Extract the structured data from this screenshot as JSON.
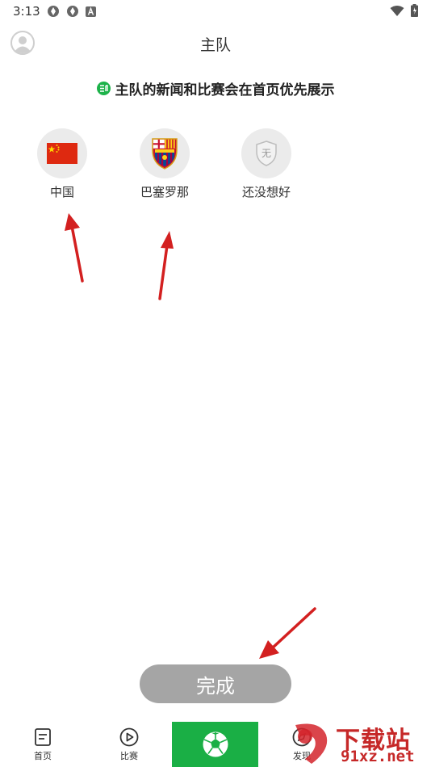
{
  "status_bar": {
    "time": "3:13"
  },
  "header": {
    "title": "主队"
  },
  "notice": {
    "text": "主队的新闻和比赛会在首页优先展示"
  },
  "teams": [
    {
      "name": "中国"
    },
    {
      "name": "巴塞罗那"
    },
    {
      "name": "还没想好",
      "badge_text": "无"
    }
  ],
  "done_button": {
    "label": "完成"
  },
  "bottom_nav": {
    "items": [
      {
        "label": "首页"
      },
      {
        "label": "比赛"
      },
      {
        "label": "发现"
      }
    ]
  },
  "watermark": {
    "brand": "下载站",
    "url": "91xz.net"
  },
  "colors": {
    "accent": "#1aaf45",
    "arrow": "#d32020",
    "button_disabled": "#a5a5a5"
  }
}
